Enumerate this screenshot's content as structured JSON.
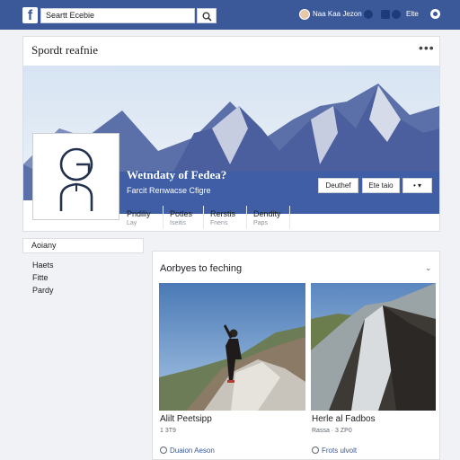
{
  "topbar": {
    "logo": "f",
    "search_value": "Seartt Ecebie",
    "user_name": "Naa Kaa Jezon",
    "help_label": "Elte"
  },
  "profile": {
    "page_title": "Spordt reafnie",
    "name": "Wetndaty of Fedea?",
    "subtitle": "Farcit Renwacse Cfigre",
    "buttons": [
      "Deuthef",
      "Ete taio",
      "• ▾"
    ],
    "stats": [
      {
        "label": "Pridiliy",
        "value": "Lay"
      },
      {
        "label": "Potles",
        "value": "Iseitis"
      },
      {
        "label": "Rerstis",
        "value": "Fnens"
      },
      {
        "label": "Dendity",
        "value": "Paps"
      }
    ]
  },
  "sidebar": {
    "heading": "Aoiany",
    "items": [
      "Haets",
      "Fitte",
      "Pardy"
    ]
  },
  "feed": {
    "title": "Aorbyes to feching",
    "posts": [
      {
        "caption": "Alilt Peetsipp",
        "meta": "1 3T9",
        "action": "Duaion Aeson"
      },
      {
        "caption": "Herle al Fadbos",
        "meta": "Rassa · 3 ZP0",
        "action": "Frots ulvolt"
      }
    ]
  }
}
